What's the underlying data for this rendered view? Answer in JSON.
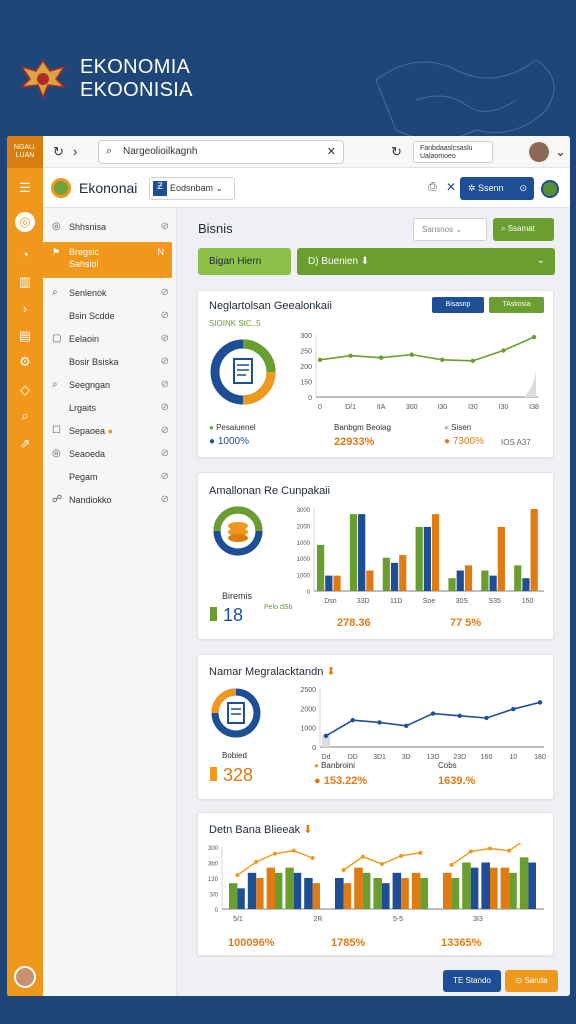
{
  "brand": {
    "line1": "EKONOMIA",
    "line2": "EKOONISIA"
  },
  "rail": {
    "top_label_1": "NGAU.",
    "top_label_2": "LUAN"
  },
  "topbar": {
    "url": "Nargeolioilkagnh",
    "dropdown": "Fanbdaaslcsaslu Ualaomoeo"
  },
  "appbar": {
    "app_title": "Ekononai",
    "project": "Eodsnbam",
    "primary_button": "Ssenn"
  },
  "sidebar": {
    "active": {
      "label": "Bregsic",
      "sub": "Sahsiol",
      "shortcut": "Ν"
    },
    "items": [
      {
        "label": "Shhsnisa"
      },
      {
        "label": "Senlenok"
      },
      {
        "label": "Bsin Scdde"
      },
      {
        "label": "Eelaoin"
      },
      {
        "label": "Bosir Bsiska"
      },
      {
        "label": "Seegngan"
      },
      {
        "label": "Lrgaits"
      },
      {
        "label": "Sepaoea"
      },
      {
        "label": "Seaoeda"
      },
      {
        "label": "Pegam"
      },
      {
        "label": "Nandiokko"
      }
    ]
  },
  "main": {
    "title": "Bisnis",
    "search_placeholder": "Sarisnos",
    "search_button": "Ssamat",
    "tab_green": "Bigan Hiern",
    "tab_bar": "D) Buenien"
  },
  "cards": [
    {
      "title": "Neglartolsan Geealonkaii",
      "subtitle": "SIOINK StC..5",
      "badge1": "Bisasnp",
      "badge2": "TAskosia",
      "legend": [
        {
          "label": "Pesaiuenel",
          "value": "1000%",
          "color": "#f0981c"
        },
        {
          "label": "Banbgm Beoiag",
          "value": "22933%",
          "color": "#1e4f96"
        },
        {
          "label": "Sisen",
          "value": "7300%",
          "color": "#888888"
        },
        {
          "label": "",
          "value": "IOS A37",
          "color": "#e07b14"
        }
      ]
    },
    {
      "title": "Amallonan Re Cunpakaii",
      "stat_label": "Biremis",
      "stat": "18",
      "stat_note": "Pelo dSb",
      "value1": "278.36",
      "value2": "77 5%"
    },
    {
      "title": "Namar Megralacktandn",
      "stat_label": "Bobied",
      "stat": "328",
      "legend1": "Banbroini",
      "legend2": "Cobs",
      "value1": "153.22%",
      "value2": "1639.%"
    },
    {
      "title": "Detn Bana Blieeak",
      "value1": "100096%",
      "value2": "1785%",
      "value3": "13365%"
    }
  ],
  "colors": {
    "orange": "#f0981c",
    "blue": "#1e4f96",
    "green": "#6a9e2e",
    "navy_bg": "#1e4678"
  },
  "chart_data": [
    {
      "type": "line",
      "series": [
        {
          "values": [
            180,
            200,
            190,
            205,
            180,
            175,
            225,
            290
          ]
        }
      ],
      "categories": [
        "0",
        "D/1",
        "IIA",
        "300",
        "I30",
        "I30",
        "I30",
        "I38"
      ],
      "y_ticks": [
        "300",
        "250",
        "200",
        "150",
        "0"
      ],
      "ylim": [
        0,
        300
      ]
    },
    {
      "type": "bar",
      "categories": [
        "Dsn",
        "33D",
        "11D",
        "Soe",
        "30S",
        "S35",
        "150"
      ],
      "series": [
        {
          "values": [
            1800,
            3000,
            1300,
            2500,
            500,
            800,
            1000
          ]
        },
        {
          "values": [
            600,
            3000,
            1100,
            2500,
            800,
            600,
            500
          ]
        },
        {
          "values": [
            600,
            800,
            1400,
            3000,
            1000,
            2500,
            3200
          ]
        }
      ],
      "y_ticks": [
        "3000",
        "2000",
        "1000",
        "1000",
        "1000",
        "0"
      ],
      "ylim": [
        0,
        3200
      ]
    },
    {
      "type": "line",
      "series": [
        {
          "values": [
            50,
            120,
            110,
            95,
            150,
            140,
            130,
            170,
            200
          ]
        }
      ],
      "categories": [
        "Dd",
        "DD",
        "3D1",
        "3D",
        "13D",
        "23D",
        "160",
        "10",
        "180"
      ],
      "y_ticks": [
        "2500",
        "2000",
        "1000",
        "0"
      ],
      "ylim": [
        0,
        260
      ]
    },
    {
      "type": "bar",
      "categories": [
        "5/1",
        "2R",
        "5-5",
        "3I3"
      ],
      "series": [
        {
          "values": [
            5,
            7,
            8,
            8,
            6
          ]
        },
        {
          "values": [
            6,
            8,
            6,
            7,
            7
          ]
        },
        {
          "values": [
            7,
            9,
            9,
            8,
            10
          ]
        }
      ],
      "y_ticks": [
        "300",
        "3b0",
        "130",
        "3/0",
        "0"
      ],
      "ylim": [
        0,
        12
      ]
    }
  ]
}
